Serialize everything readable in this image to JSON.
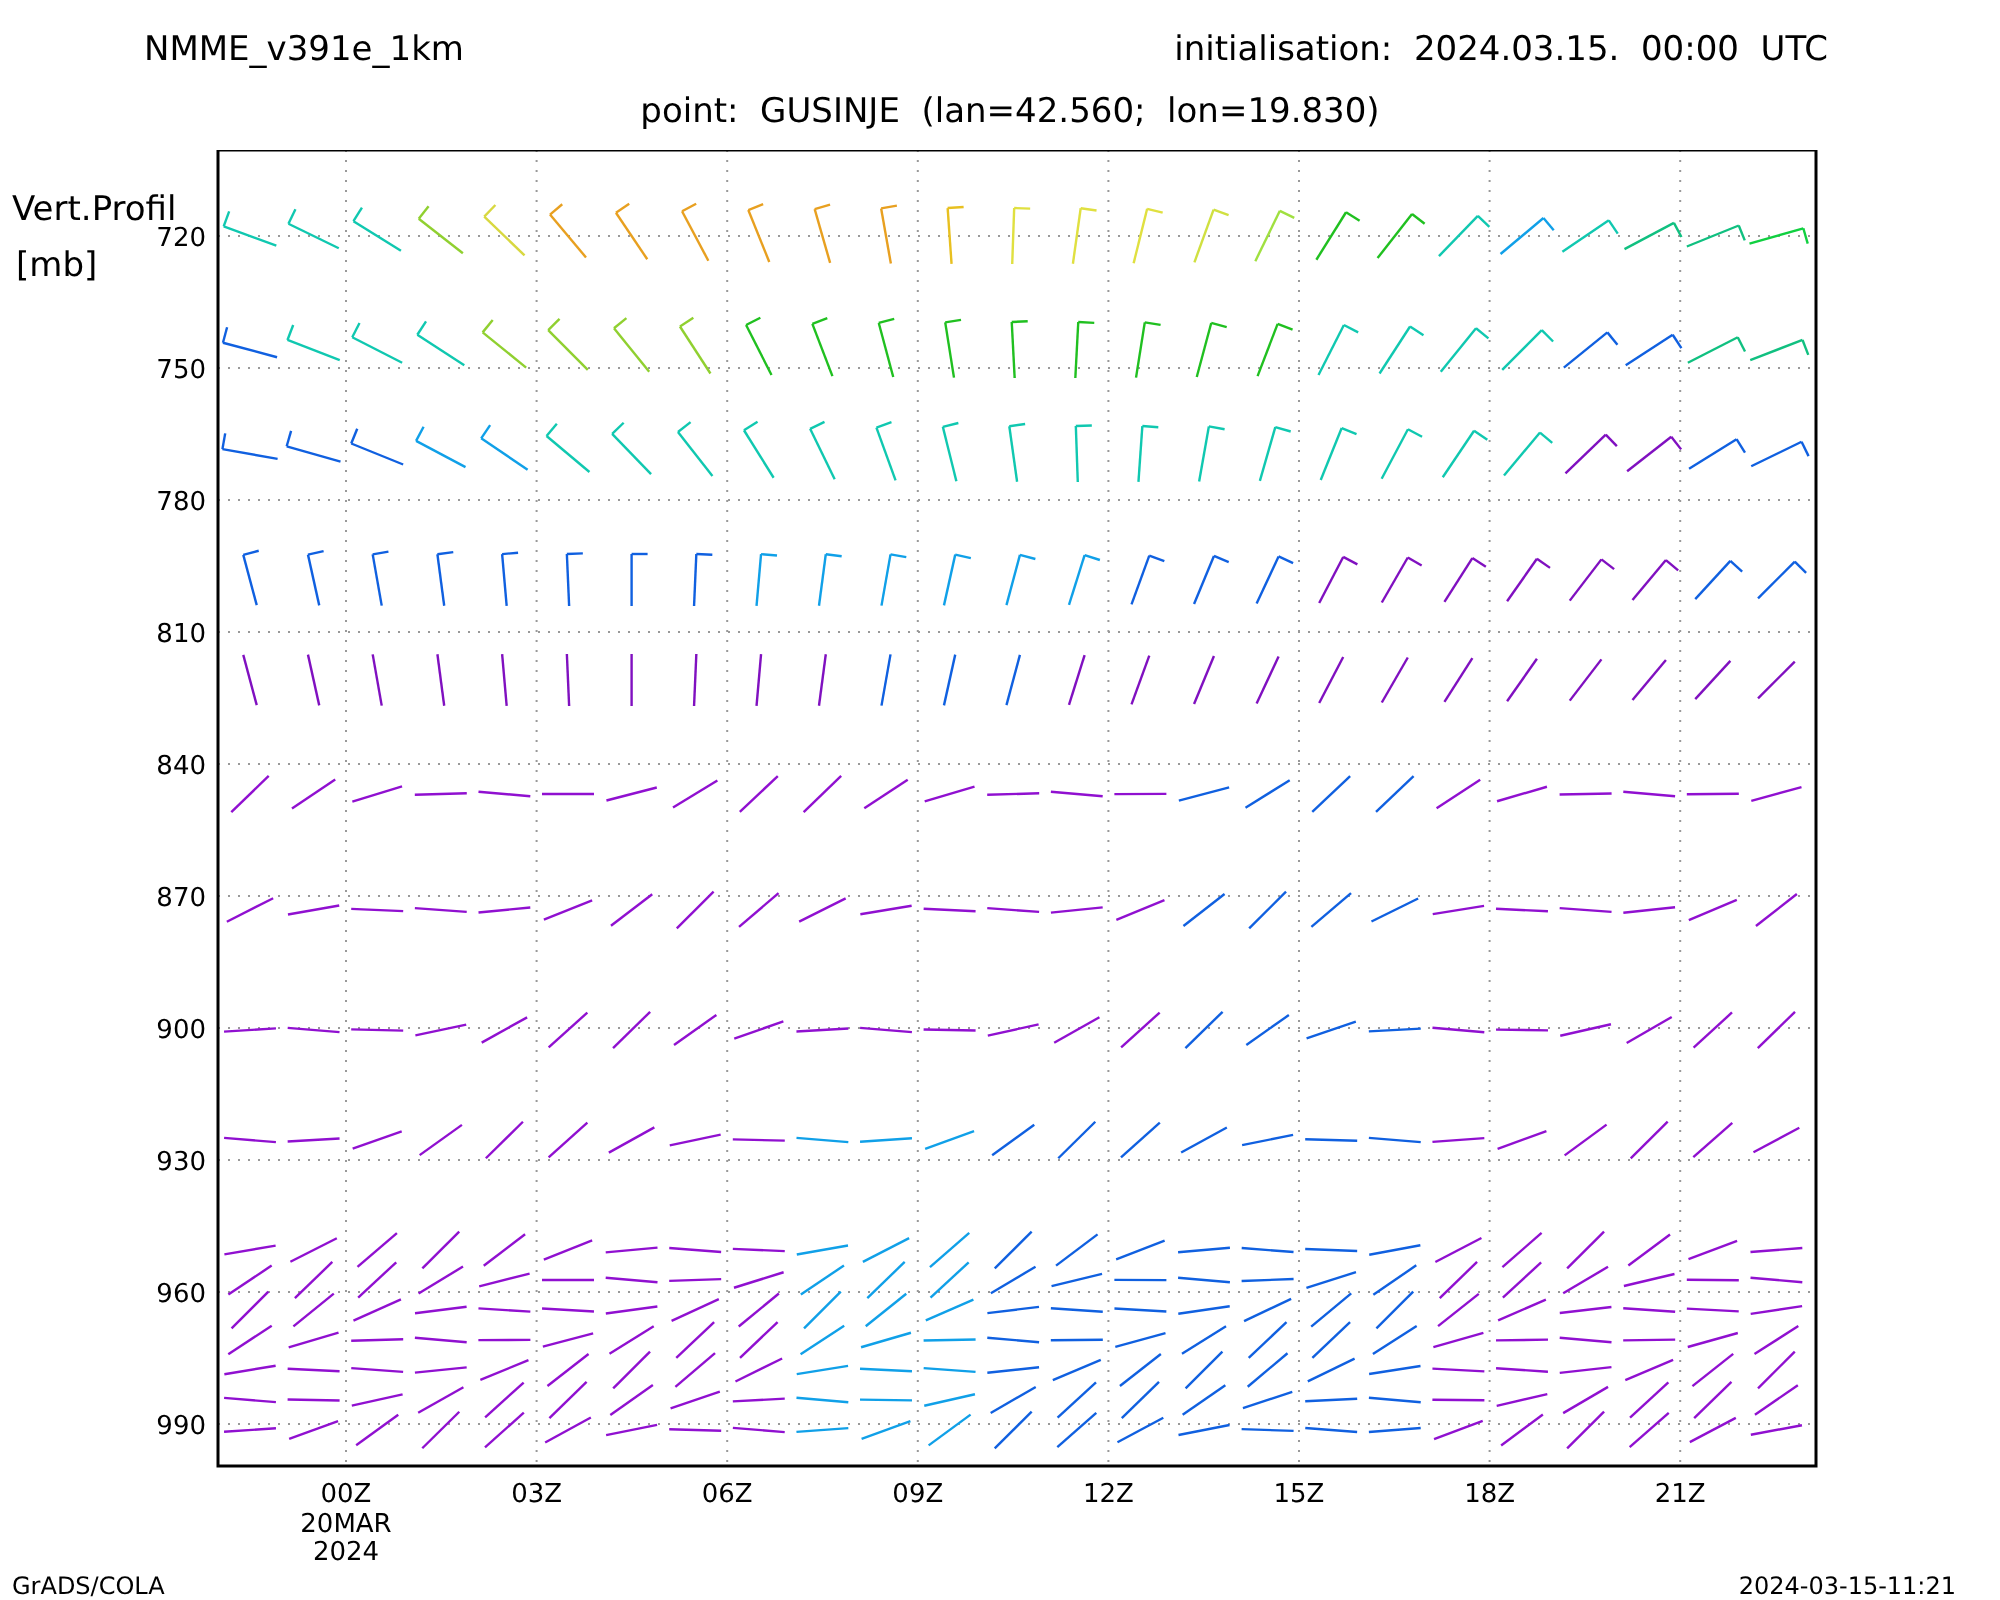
{
  "header": {
    "model": "NMME_v391e_1km",
    "initialisation": "initialisation:  2024.03.15.  00:00  UTC",
    "point": "point:  GUSINJE  (lan=42.560;  lon=19.830)"
  },
  "y_axis": {
    "title_lines": [
      "Vert.Profil",
      "[mb]"
    ],
    "ticks": [
      "720",
      "750",
      "780",
      "810",
      "840",
      "870",
      "900",
      "930",
      "960",
      "990"
    ]
  },
  "x_axis": {
    "ticks": [
      {
        "label": "00Z",
        "sublabels": [
          "20MAR",
          "2024"
        ]
      },
      {
        "label": "03Z"
      },
      {
        "label": "06Z"
      },
      {
        "label": "09Z"
      },
      {
        "label": "12Z"
      },
      {
        "label": "15Z"
      },
      {
        "label": "18Z"
      },
      {
        "label": "21Z"
      }
    ]
  },
  "footer": {
    "left": "GrADS/COLA",
    "right": "2024-03-15-11:21"
  }
}
